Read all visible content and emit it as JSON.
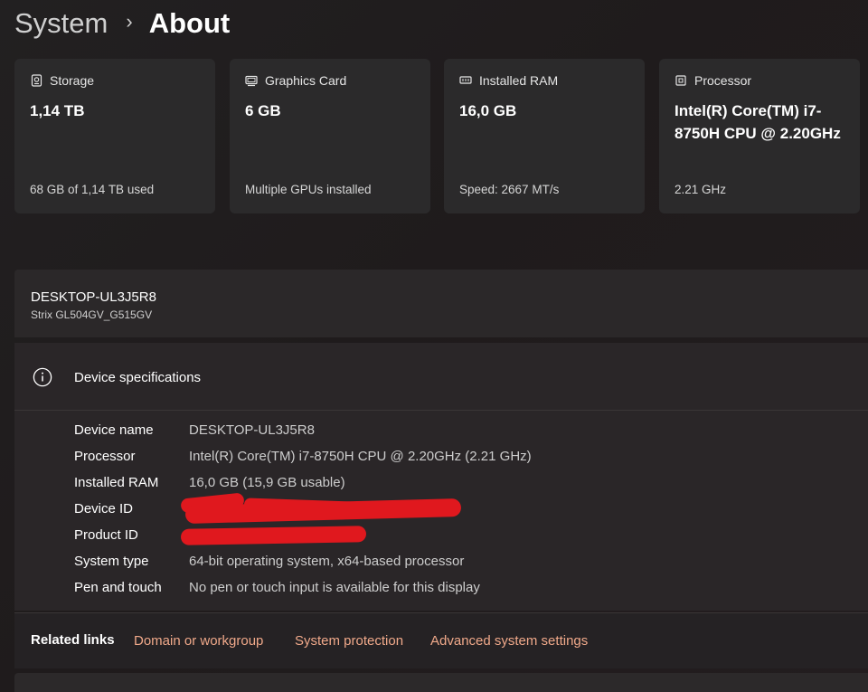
{
  "breadcrumb": {
    "parent": "System",
    "separator": "›",
    "current": "About"
  },
  "cards": [
    {
      "icon": "storage-icon",
      "title": "Storage",
      "value": "1,14 TB",
      "sub": "68 GB of 1,14 TB used"
    },
    {
      "icon": "graphics-card-icon",
      "title": "Graphics Card",
      "value": "6 GB",
      "sub": "Multiple GPUs installed"
    },
    {
      "icon": "ram-icon",
      "title": "Installed RAM",
      "value": "16,0 GB",
      "sub": "Speed: 2667 MT/s"
    },
    {
      "icon": "processor-icon",
      "title": "Processor",
      "value": "Intel(R) Core(TM) i7-8750H CPU @ 2.20GHz",
      "sub": "2.21 GHz"
    }
  ],
  "device": {
    "name": "DESKTOP-UL3J5R8",
    "model": "Strix GL504GV_G515GV"
  },
  "specs": {
    "title": "Device specifications",
    "icon": "info-icon",
    "rows": [
      {
        "label": "Device name",
        "value": "DESKTOP-UL3J5R8"
      },
      {
        "label": "Processor",
        "value": "Intel(R) Core(TM) i7-8750H CPU @ 2.20GHz (2.21 GHz)"
      },
      {
        "label": "Installed RAM",
        "value": "16,0 GB (15,9 GB usable)"
      },
      {
        "label": "Device ID",
        "value": ""
      },
      {
        "label": "Product ID",
        "value": ""
      },
      {
        "label": "System type",
        "value": "64-bit operating system, x64-based processor"
      },
      {
        "label": "Pen and touch",
        "value": "No pen or touch input is available for this display"
      }
    ]
  },
  "related": {
    "label": "Related links",
    "links": [
      "Domain or workgroup",
      "System protection",
      "Advanced system settings"
    ]
  },
  "colors": {
    "link": "#f0a98a",
    "redaction": "#e0181e"
  }
}
